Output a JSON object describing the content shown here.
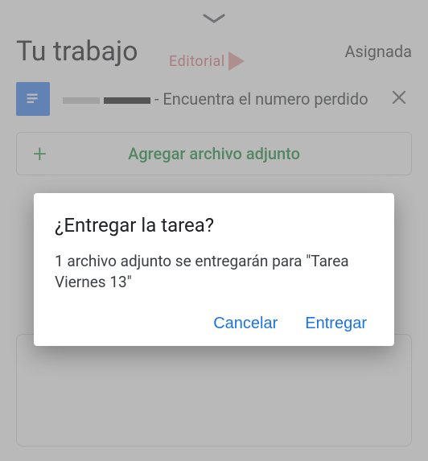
{
  "header": {
    "title": "Tu trabajo",
    "status": "Asignada"
  },
  "watermark": {
    "text": "Editorial"
  },
  "attachment": {
    "name_suffix": "- Encuentra el numero perdido"
  },
  "add_button": {
    "label": "Agregar archivo adjunto"
  },
  "dialog": {
    "title": "¿Entregar la tarea?",
    "message": "1 archivo adjunto se entregarán para \"Tarea Viernes 13\"",
    "cancel": "Cancelar",
    "confirm": "Entregar"
  }
}
